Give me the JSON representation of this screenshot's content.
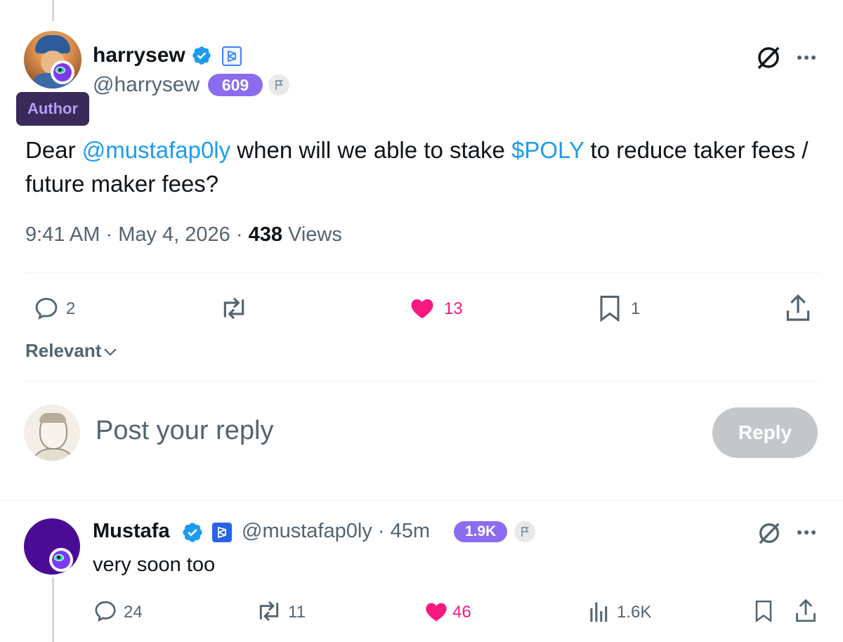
{
  "post": {
    "author": {
      "name": "harrysew",
      "handle": "@harrysew",
      "score": "609",
      "role_tag": "Author",
      "avatar": "profile-avatar"
    },
    "text_parts": {
      "p1": "Dear ",
      "mention": "@mustafap0ly",
      "p2": " when will we able to stake ",
      "ticker": "$POLY",
      "p3": " to reduce taker fees / future maker fees?"
    },
    "meta": {
      "time": "9:41 AM",
      "sep1": " · ",
      "date": "May 4, 2026",
      "sep2": " · ",
      "views": "438",
      "views_label": " Views"
    },
    "actions": {
      "replies": "2",
      "reposts": "",
      "likes": "13",
      "bookmarks": "1"
    }
  },
  "sort": {
    "label": "Relevant"
  },
  "composer": {
    "placeholder": "Post your reply",
    "button": "Reply"
  },
  "reply": {
    "name": "Mustafa",
    "handle": "@mustafap0ly",
    "time": "· 45m",
    "score": "1.9K",
    "text": "very soon too",
    "actions": {
      "replies": "24",
      "reposts": "11",
      "likes": "46",
      "views": "1.6K"
    }
  },
  "colors": {
    "accent": "#1d9bf0",
    "like": "#f91880",
    "pill": "#8b6cf0",
    "author_tag_bg": "#3a2a5a"
  },
  "icons": [
    "verified-badge-icon",
    "brand-square-icon",
    "flag-icon",
    "no-grok-icon",
    "more-icon",
    "reply-icon",
    "repost-icon",
    "heart-icon",
    "bookmark-icon",
    "share-icon",
    "views-icon",
    "chevron-down-icon",
    "eye-badge-icon"
  ]
}
